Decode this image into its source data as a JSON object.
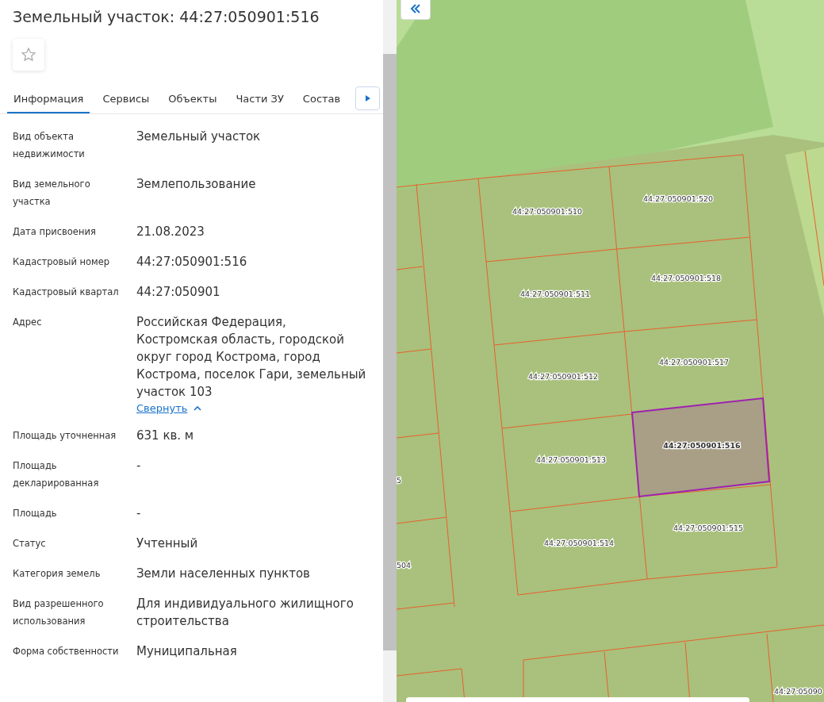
{
  "title": "Земельный участок: 44:27:050901:516",
  "favorite": {
    "on": false
  },
  "tabs": [
    {
      "label": "Информация",
      "selected": true
    },
    {
      "label": "Сервисы",
      "selected": false
    },
    {
      "label": "Объекты",
      "selected": false
    },
    {
      "label": "Части ЗУ",
      "selected": false
    },
    {
      "label": "Состав",
      "selected": false
    }
  ],
  "fields": [
    {
      "label": "Вид объекта недвижимости",
      "value": "Земельный участок"
    },
    {
      "label": "Вид земельного участка",
      "value": "Землепользование"
    },
    {
      "label": "Дата присвоения",
      "value": "21.08.2023"
    },
    {
      "label": "Кадастровый номер",
      "value": "44:27:050901:516"
    },
    {
      "label": "Кадастровый квартал",
      "value": "44:27:050901"
    },
    {
      "label": "Адрес",
      "value": "Российская Федерация, Костромская область, городской округ город Кострома, город Кострома, поселок Гари, земельный участок 103",
      "toggle": {
        "label": "Свернуть",
        "expanded": true
      }
    },
    {
      "label": "Площадь уточненная",
      "value": "631 кв. м"
    },
    {
      "label": "Площадь декларированная",
      "value": "-"
    },
    {
      "label": "Площадь",
      "value": "-"
    },
    {
      "label": "Статус",
      "value": "Учтенный"
    },
    {
      "label": "Категория земель",
      "value": "Земли населенных пунктов"
    },
    {
      "label": "Вид разрешенного использования",
      "value": "Для индивидуального жилищного строительства"
    },
    {
      "label": "Форма собственности",
      "value": "Муниципальная"
    }
  ],
  "map": {
    "parcels": [
      {
        "label": "44:27:050901:510",
        "selected": false
      },
      {
        "label": "44:27:050901:520",
        "selected": false
      },
      {
        "label": "44:27:050901:511",
        "selected": false
      },
      {
        "label": "44:27:050901:518",
        "selected": false
      },
      {
        "label": "44:27:050901:512",
        "selected": false
      },
      {
        "label": "44:27:050901:517",
        "selected": false
      },
      {
        "label": "44:27:050901:513",
        "selected": false
      },
      {
        "label": "44:27:050901:516",
        "selected": true
      },
      {
        "label": "44:27:050901:514",
        "selected": false
      },
      {
        "label": "44:27:050901:515",
        "selected": false
      },
      {
        "label": "5",
        "selected": false
      },
      {
        "label": "504",
        "selected": false
      },
      {
        "label": "44:27:05090",
        "selected": false
      }
    ]
  }
}
